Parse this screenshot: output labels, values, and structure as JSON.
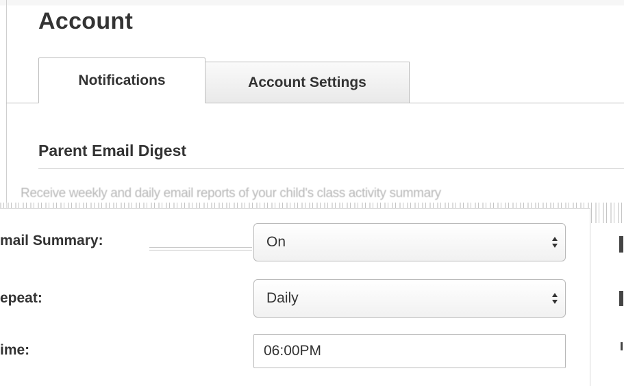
{
  "page": {
    "title": "Account"
  },
  "tabs": [
    {
      "label": "Notifications",
      "active": true
    },
    {
      "label": "Account Settings",
      "active": false
    }
  ],
  "section": {
    "heading": "Parent Email Digest",
    "description": "Receive weekly and daily email reports of your child's class activity summary"
  },
  "form": {
    "email_summary": {
      "label": "mail Summary:",
      "value": "On",
      "icon": "select-arrows-icon"
    },
    "repeat": {
      "label": "epeat:",
      "value": "Daily",
      "icon": "select-arrows-icon"
    },
    "time": {
      "label": "ime:",
      "value": "06:00PM"
    }
  },
  "colors": {
    "text": "#333333",
    "border": "#bdbdbd",
    "inactive_tab_bg": "#ececec",
    "faded_text": "#b8b8b8"
  }
}
